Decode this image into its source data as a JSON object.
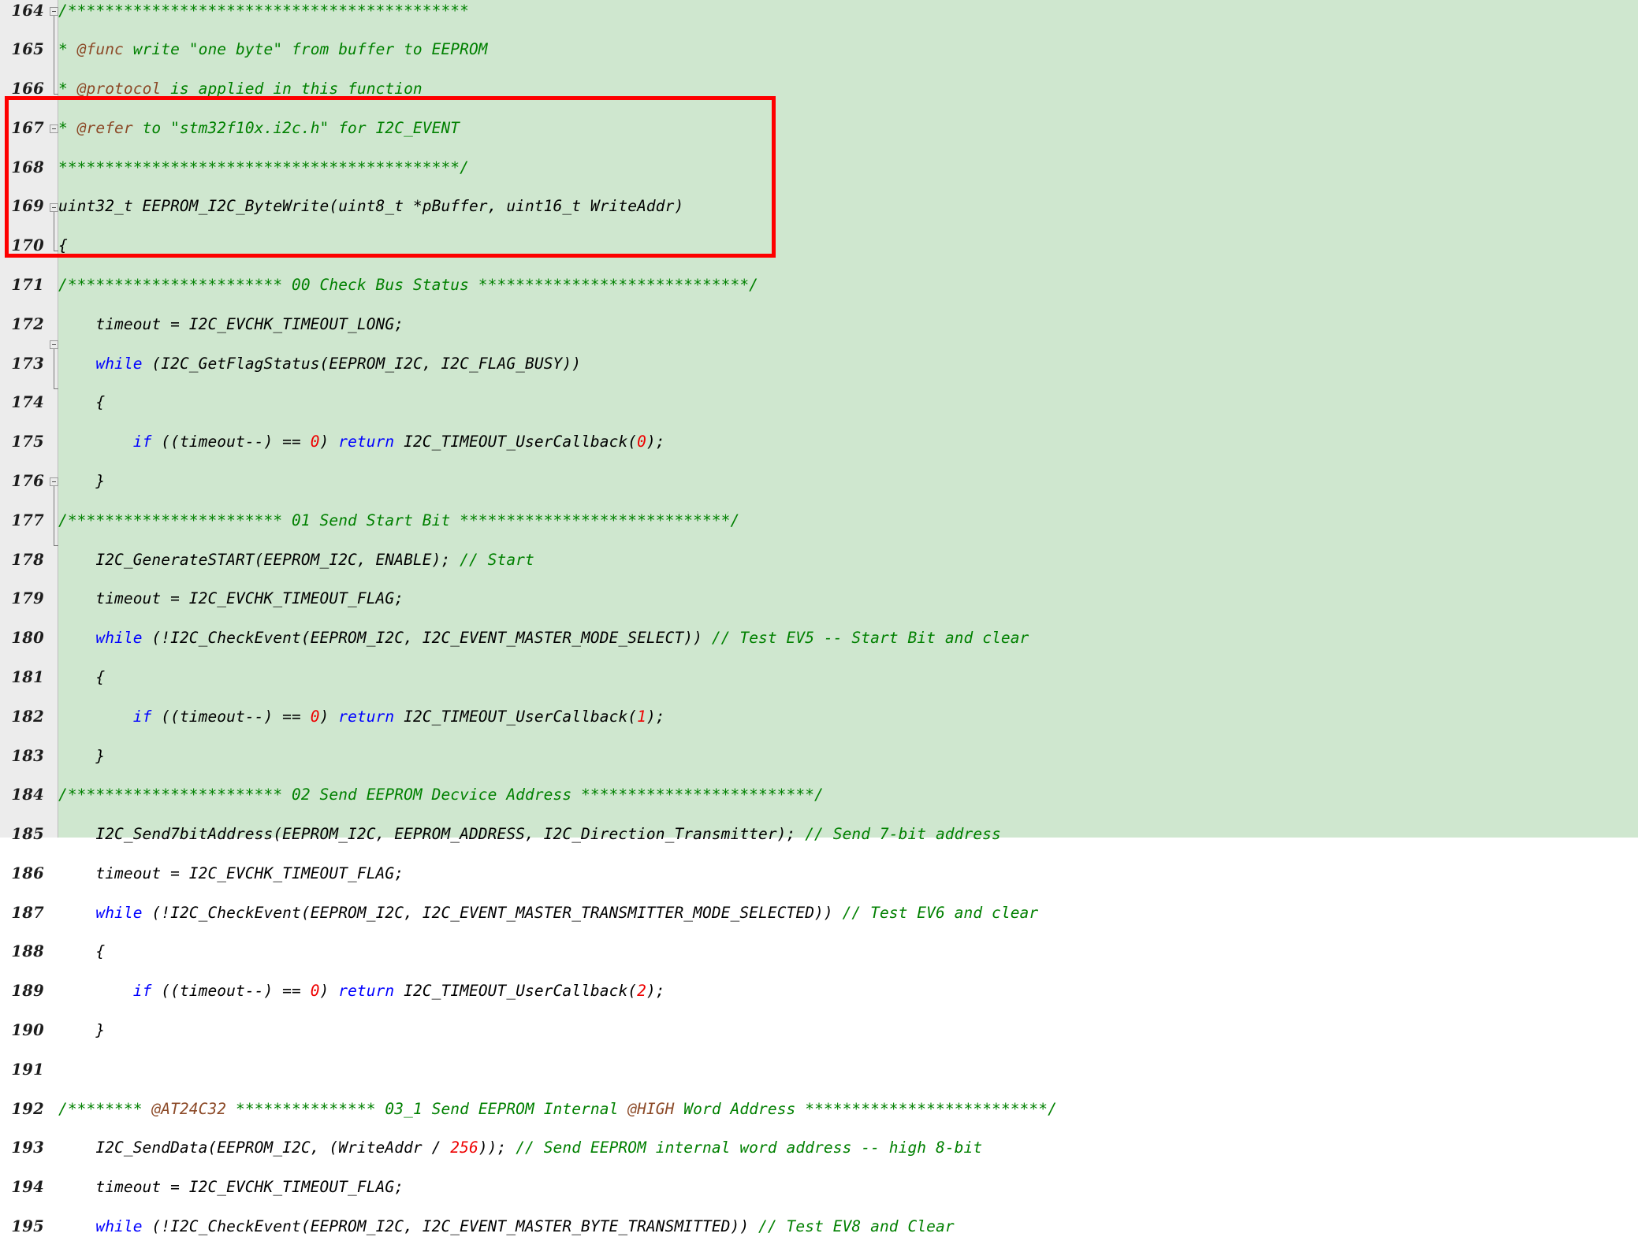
{
  "editor": {
    "background_color": "#cfe7cf",
    "gutter_color": "#ececec",
    "colors": {
      "comment": "#008000",
      "doc_tag": "#8c4a28",
      "keyword": "#0000ff",
      "number": "#ee0000",
      "plain": "#000000",
      "annotation": "#fe0000"
    }
  },
  "annotation": {
    "label": "red-highlight-rectangle",
    "covers_lines": "169-176"
  },
  "lines": [
    {
      "number": "164",
      "fold": "start",
      "tokens": [
        {
          "t": "/*******************************************",
          "c": "cmt"
        }
      ]
    },
    {
      "number": "165",
      "fold": "mid",
      "tokens": [
        {
          "t": "* ",
          "c": "cmt"
        },
        {
          "t": "@func",
          "c": "tag"
        },
        {
          "t": " write \"one byte\" from buffer to EEPROM",
          "c": "cmt"
        }
      ]
    },
    {
      "number": "166",
      "fold": "mid",
      "tokens": [
        {
          "t": "* ",
          "c": "cmt"
        },
        {
          "t": "@protocol",
          "c": "tag"
        },
        {
          "t": " is applied in this function",
          "c": "cmt"
        }
      ]
    },
    {
      "number": "167",
      "fold": "mid",
      "tokens": [
        {
          "t": "* ",
          "c": "cmt"
        },
        {
          "t": "@refer",
          "c": "tag"
        },
        {
          "t": " to \"stm32f10x.i2c.h\" for I2C_EVENT",
          "c": "cmt"
        }
      ]
    },
    {
      "number": "168",
      "fold": "end",
      "tokens": [
        {
          "t": "*******************************************/",
          "c": "cmt"
        }
      ]
    },
    {
      "number": "169",
      "fold": "none",
      "tokens": [
        {
          "t": "uint32_t EEPROM_I2C_ByteWrite(uint8_t *pBuffer, uint16_t WriteAddr)",
          "c": "pln"
        }
      ]
    },
    {
      "number": "170",
      "fold": "start",
      "tokens": [
        {
          "t": "{",
          "c": "pln"
        }
      ]
    },
    {
      "number": "171",
      "fold": "mid",
      "tokens": [
        {
          "t": "/*********************** 00 Check Bus Status *****************************/",
          "c": "cmt"
        }
      ]
    },
    {
      "number": "172",
      "fold": "mid",
      "tokens": [
        {
          "t": "    timeout = I2C_EVCHK_TIMEOUT_LONG;",
          "c": "pln"
        }
      ]
    },
    {
      "number": "173",
      "fold": "mid",
      "tokens": [
        {
          "t": "    ",
          "c": "pln"
        },
        {
          "t": "while",
          "c": "kw"
        },
        {
          "t": " (I2C_GetFlagStatus(EEPROM_I2C, I2C_FLAG_BUSY))",
          "c": "pln"
        }
      ]
    },
    {
      "number": "174",
      "fold": "start",
      "tokens": [
        {
          "t": "    {",
          "c": "pln"
        }
      ]
    },
    {
      "number": "175",
      "fold": "mid",
      "tokens": [
        {
          "t": "        ",
          "c": "pln"
        },
        {
          "t": "if",
          "c": "kw"
        },
        {
          "t": " ((timeout--) == ",
          "c": "pln"
        },
        {
          "t": "0",
          "c": "num"
        },
        {
          "t": ") ",
          "c": "pln"
        },
        {
          "t": "return",
          "c": "kw"
        },
        {
          "t": " I2C_TIMEOUT_UserCallback(",
          "c": "pln"
        },
        {
          "t": "0",
          "c": "num"
        },
        {
          "t": ");",
          "c": "pln"
        }
      ]
    },
    {
      "number": "176",
      "fold": "end",
      "tokens": [
        {
          "t": "    }",
          "c": "pln"
        }
      ]
    },
    {
      "number": "177",
      "fold": "mid",
      "tokens": [
        {
          "t": "/*********************** 01 Send Start Bit *****************************/",
          "c": "cmt"
        }
      ]
    },
    {
      "number": "178",
      "fold": "mid",
      "tokens": [
        {
          "t": "    I2C_GenerateSTART(EEPROM_I2C, ENABLE); ",
          "c": "pln"
        },
        {
          "t": "// Start",
          "c": "cmt"
        }
      ]
    },
    {
      "number": "179",
      "fold": "mid",
      "tokens": [
        {
          "t": "    timeout = I2C_EVCHK_TIMEOUT_FLAG;",
          "c": "pln"
        }
      ]
    },
    {
      "number": "180",
      "fold": "mid",
      "tokens": [
        {
          "t": "    ",
          "c": "pln"
        },
        {
          "t": "while",
          "c": "kw"
        },
        {
          "t": " (!I2C_CheckEvent(EEPROM_I2C, I2C_EVENT_MASTER_MODE_SELECT)) ",
          "c": "pln"
        },
        {
          "t": "// Test EV5 -- Start Bit and clear",
          "c": "cmt"
        }
      ]
    },
    {
      "number": "181",
      "fold": "start",
      "tokens": [
        {
          "t": "    {",
          "c": "pln"
        }
      ]
    },
    {
      "number": "182",
      "fold": "mid",
      "tokens": [
        {
          "t": "        ",
          "c": "pln"
        },
        {
          "t": "if",
          "c": "kw"
        },
        {
          "t": " ((timeout--) == ",
          "c": "pln"
        },
        {
          "t": "0",
          "c": "num"
        },
        {
          "t": ") ",
          "c": "pln"
        },
        {
          "t": "return",
          "c": "kw"
        },
        {
          "t": " I2C_TIMEOUT_UserCallback(",
          "c": "pln"
        },
        {
          "t": "1",
          "c": "num"
        },
        {
          "t": ");",
          "c": "pln"
        }
      ]
    },
    {
      "number": "183",
      "fold": "end",
      "tokens": [
        {
          "t": "    }",
          "c": "pln"
        }
      ]
    },
    {
      "number": "184",
      "fold": "mid",
      "tokens": [
        {
          "t": "/*********************** 02 Send EEPROM Decvice Address *************************/",
          "c": "cmt"
        }
      ]
    },
    {
      "number": "185",
      "fold": "mid",
      "tokens": [
        {
          "t": "    I2C_Send7bitAddress(EEPROM_I2C, EEPROM_ADDRESS, I2C_Direction_Transmitter); ",
          "c": "pln"
        },
        {
          "t": "// Send 7-bit address",
          "c": "cmt"
        }
      ]
    },
    {
      "number": "186",
      "fold": "mid",
      "tokens": [
        {
          "t": "    timeout = I2C_EVCHK_TIMEOUT_FLAG;",
          "c": "pln"
        }
      ]
    },
    {
      "number": "187",
      "fold": "mid",
      "tokens": [
        {
          "t": "    ",
          "c": "pln"
        },
        {
          "t": "while",
          "c": "kw"
        },
        {
          "t": " (!I2C_CheckEvent(EEPROM_I2C, I2C_EVENT_MASTER_TRANSMITTER_MODE_SELECTED)) ",
          "c": "pln"
        },
        {
          "t": "// Test EV6 and clear",
          "c": "cmt"
        }
      ]
    },
    {
      "number": "188",
      "fold": "start",
      "tokens": [
        {
          "t": "    {",
          "c": "pln"
        }
      ]
    },
    {
      "number": "189",
      "fold": "mid",
      "tokens": [
        {
          "t": "        ",
          "c": "pln"
        },
        {
          "t": "if",
          "c": "kw"
        },
        {
          "t": " ((timeout--) == ",
          "c": "pln"
        },
        {
          "t": "0",
          "c": "num"
        },
        {
          "t": ") ",
          "c": "pln"
        },
        {
          "t": "return",
          "c": "kw"
        },
        {
          "t": " I2C_TIMEOUT_UserCallback(",
          "c": "pln"
        },
        {
          "t": "2",
          "c": "num"
        },
        {
          "t": ");",
          "c": "pln"
        }
      ]
    },
    {
      "number": "190",
      "fold": "mid",
      "tokens": [
        {
          "t": "    }",
          "c": "pln"
        }
      ]
    },
    {
      "number": "191",
      "fold": "end",
      "tokens": []
    },
    {
      "number": "192",
      "fold": "mid",
      "tokens": [
        {
          "t": "/******** ",
          "c": "cmt"
        },
        {
          "t": "@AT24C32",
          "c": "tag"
        },
        {
          "t": " *************** 03_1 Send EEPROM Internal ",
          "c": "cmt"
        },
        {
          "t": "@HIGH",
          "c": "tag"
        },
        {
          "t": " Word Address **************************/",
          "c": "cmt"
        }
      ]
    },
    {
      "number": "193",
      "fold": "mid",
      "tokens": [
        {
          "t": "    I2C_SendData(EEPROM_I2C, (WriteAddr / ",
          "c": "pln"
        },
        {
          "t": "256",
          "c": "num"
        },
        {
          "t": ")); ",
          "c": "pln"
        },
        {
          "t": "// Send EEPROM internal word address -- high 8-bit",
          "c": "cmt"
        }
      ]
    },
    {
      "number": "194",
      "fold": "mid",
      "tokens": [
        {
          "t": "    timeout = I2C_EVCHK_TIMEOUT_FLAG;",
          "c": "pln"
        }
      ]
    },
    {
      "number": "195",
      "fold": "mid",
      "tokens": [
        {
          "t": "    ",
          "c": "pln"
        },
        {
          "t": "while",
          "c": "kw"
        },
        {
          "t": " (!I2C_CheckEvent(EEPROM_I2C, I2C_EVENT_MASTER_BYTE_TRANSMITTED)) ",
          "c": "pln"
        },
        {
          "t": "// Test EV8 and Clear",
          "c": "cmt"
        }
      ]
    }
  ]
}
